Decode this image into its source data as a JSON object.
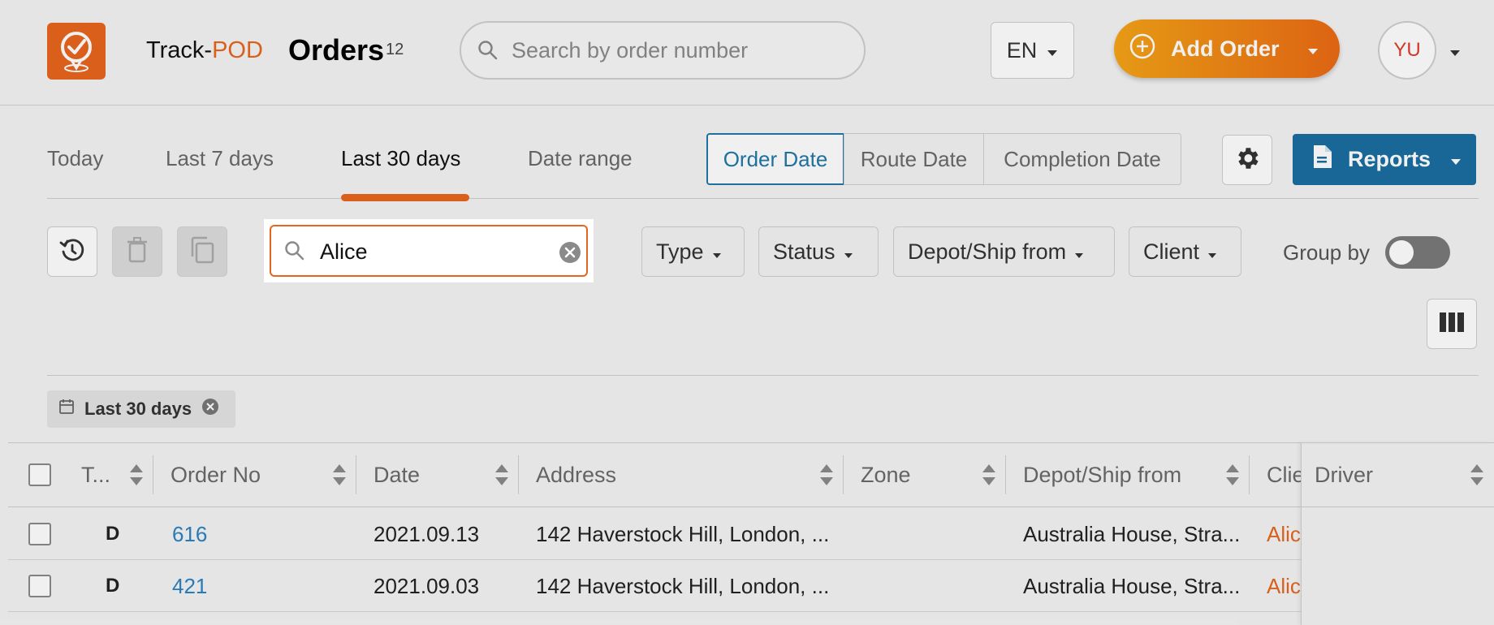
{
  "header": {
    "brand_prefix": "Track-",
    "brand_suffix": "POD",
    "title": "Orders",
    "order_count": "12",
    "search_placeholder": "Search by order number",
    "language": "EN",
    "add_order_label": "Add Order",
    "avatar_initials": "YU"
  },
  "date_tabs": [
    "Today",
    "Last 7 days",
    "Last 30 days",
    "Date range"
  ],
  "active_date_tab": "Last 30 days",
  "date_types": [
    "Order Date",
    "Route Date",
    "Completion Date"
  ],
  "active_date_type": "Order Date",
  "reports_label": "Reports",
  "filters": {
    "search_value": "Alice",
    "type_label": "Type",
    "status_label": "Status",
    "depot_label": "Depot/Ship from",
    "client_label": "Client",
    "group_by_label": "Group by",
    "group_by_enabled": false
  },
  "chip_label": "Last 30 days",
  "table": {
    "columns": [
      "T...",
      "Order No",
      "Date",
      "Address",
      "Zone",
      "Depot/Ship from",
      "Clie",
      "Driver"
    ],
    "rows": [
      {
        "type": "D",
        "order_no": "616",
        "date": "2021.09.13",
        "address": "142 Haverstock Hill, London, ...",
        "zone": "",
        "depot": "Australia House, Stra...",
        "client": "Alic",
        "driver": ""
      },
      {
        "type": "D",
        "order_no": "421",
        "date": "2021.09.03",
        "address": "142 Haverstock Hill, London, ...",
        "zone": "",
        "depot": "Australia House, Stra...",
        "client": "Alic",
        "driver": ""
      }
    ]
  },
  "colors": {
    "brand_orange": "#e8651d",
    "primary_blue": "#1a6ea1",
    "link_blue": "#2b83c2"
  }
}
